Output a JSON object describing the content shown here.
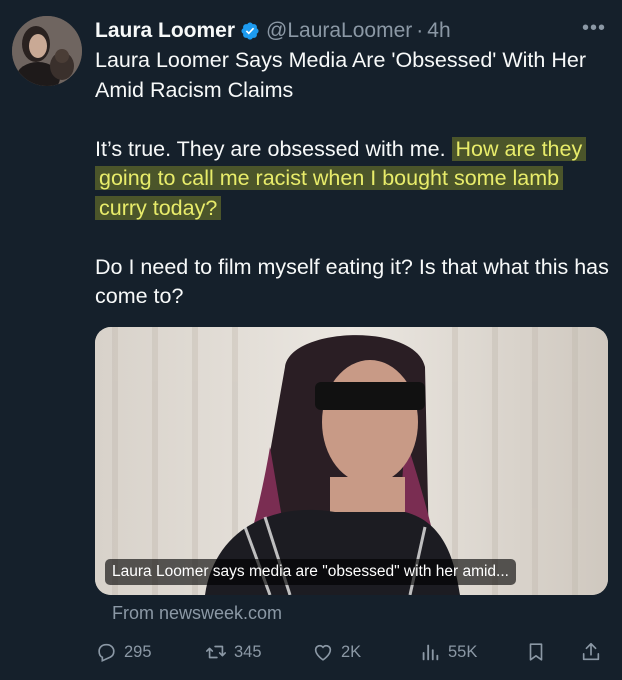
{
  "author": {
    "display_name": "Laura Loomer",
    "verified_icon": "verified-badge-icon",
    "handle": "@LauraLoomer",
    "separator": "·",
    "time": "4h",
    "more_icon": "more-dots-icon"
  },
  "tweet": {
    "line1": "Laura Loomer Says Media Are 'Obsessed' With Her Amid Racism Claims",
    "para2_plain": "It’s true. They are obsessed with me.",
    "para2_highlighted": "How are they going to call me racist when I bought some lamb curry today?",
    "para3": "Do I need to film myself eating it? Is that what this has come to?"
  },
  "link_card": {
    "caption": "Laura Loomer says media are \"obsessed\" with her amid...",
    "source": "From newsweek.com"
  },
  "actions": {
    "replies": "295",
    "reposts": "345",
    "likes": "2K",
    "views": "55K"
  },
  "colors": {
    "background": "#15202b",
    "text": "#f7f9f9",
    "secondary": "#8b98a5",
    "verified": "#1d9bf0",
    "highlight": "#e8ec6a"
  }
}
